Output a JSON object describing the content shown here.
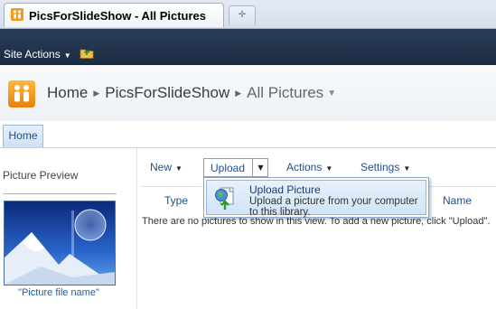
{
  "browser": {
    "tab_title": "PicsForSlideShow - All Pictures",
    "new_tab_glyph": "✛"
  },
  "ribbon": {
    "site_actions_label": "Site Actions",
    "caret": "▼"
  },
  "title_area": {
    "breadcrumb": [
      "Home",
      "PicsForSlideShow",
      "All Pictures"
    ],
    "separator": "▶",
    "dropdown_glyph": "▼"
  },
  "top_nav": {
    "items": [
      {
        "label": "Home"
      }
    ]
  },
  "left_panel": {
    "heading": "Picture Preview",
    "caption": "\"Picture file name\""
  },
  "toolbar": {
    "new_label": "New",
    "upload_label": "Upload",
    "actions_label": "Actions",
    "settings_label": "Settings"
  },
  "list": {
    "columns": [
      "Type",
      "Name"
    ],
    "empty_message": "There are no pictures to show in this view. To add a new picture, click \"Upload\"."
  },
  "upload_menu": {
    "items": [
      {
        "title": "Upload Picture",
        "description": "Upload a picture from your computer to this library.",
        "icon": "upload-picture-icon"
      }
    ]
  },
  "colors": {
    "sitebar": "#21324c",
    "link": "#1f4f8a",
    "menu_highlight": "#d1e4f7",
    "accent_orange": "#f39a1d"
  }
}
